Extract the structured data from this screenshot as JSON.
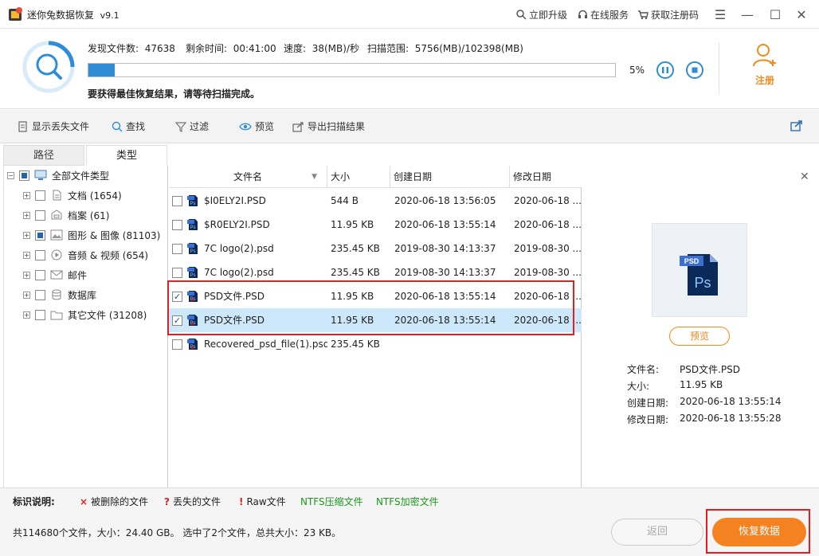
{
  "app": {
    "title": "迷你兔数据恢复",
    "version": "v9.1",
    "links": {
      "upgrade": "立即升级",
      "service": "在线服务",
      "get_code": "获取注册码"
    }
  },
  "scan": {
    "found_label": "发现文件数:",
    "found_value": "47638",
    "remaining_label": "剩余时间:",
    "remaining_value": "00:41:00",
    "speed_label": "速度:",
    "speed_value": "38(MB)/秒",
    "range_label": "扫描范围:",
    "range_value": "5756(MB)/102398(MB)",
    "progress_percent": 5,
    "progress_text": "5%",
    "message": "要获得最佳恢复结果，请等待扫描完成。",
    "register_label": "注册"
  },
  "toolbar": {
    "show_lost": "显示丢失文件",
    "find": "查找",
    "filter": "过滤",
    "preview": "预览",
    "export": "导出扫描结果"
  },
  "tabs": {
    "path": "路径",
    "type": "类型"
  },
  "tree": {
    "root": "全部文件类型",
    "items": [
      {
        "label": "文档 (1654)",
        "icon": "document-icon",
        "state": "none"
      },
      {
        "label": "档案 (61)",
        "icon": "archive-icon",
        "state": "none"
      },
      {
        "label": "图形 & 图像 (81103)",
        "icon": "image-icon",
        "state": "partial"
      },
      {
        "label": "音频 & 视频 (654)",
        "icon": "media-icon",
        "state": "none"
      },
      {
        "label": "邮件",
        "icon": "mail-icon",
        "state": "none"
      },
      {
        "label": "数据库",
        "icon": "database-icon",
        "state": "none"
      },
      {
        "label": "其它文件 (31208)",
        "icon": "folder-icon",
        "state": "none"
      }
    ]
  },
  "table": {
    "headers": {
      "name": "文件名",
      "size": "大小",
      "created": "创建日期",
      "modified": "修改日期"
    },
    "rows": [
      {
        "name": "$I0ELY2I.PSD",
        "size": "544 B",
        "created": "2020-06-18 13:56:05",
        "modified": "2020-06-18 ...",
        "checked": false,
        "deleted": false
      },
      {
        "name": "$R0ELY2I.PSD",
        "size": "11.95 KB",
        "created": "2020-06-18 13:55:14",
        "modified": "2020-06-18 ...",
        "checked": false,
        "deleted": false
      },
      {
        "name": "7C logo(2).psd",
        "size": "235.45 KB",
        "created": "2019-08-30 14:13:37",
        "modified": "2019-08-30 ...",
        "checked": false,
        "deleted": false
      },
      {
        "name": "7C logo(2).psd",
        "size": "235.45 KB",
        "created": "2019-08-30 14:13:37",
        "modified": "2019-08-30 ...",
        "checked": false,
        "deleted": false
      },
      {
        "name": "PSD文件.PSD",
        "size": "11.95 KB",
        "created": "2020-06-18 13:55:14",
        "modified": "2020-06-18 ...",
        "checked": true,
        "deleted": true
      },
      {
        "name": "PSD文件.PSD",
        "size": "11.95 KB",
        "created": "2020-06-18 13:55:14",
        "modified": "2020-06-18 ...",
        "checked": true,
        "deleted": true
      },
      {
        "name": "Recovered_psd_file(1).psd",
        "size": "235.45 KB",
        "created": "",
        "modified": "",
        "checked": false,
        "deleted": true
      }
    ]
  },
  "preview": {
    "thumb_badge": "PSD",
    "thumb_text": "Ps",
    "button": "预览",
    "name_label": "文件名:",
    "name_value": "PSD文件.PSD",
    "size_label": "大小:",
    "size_value": "11.95 KB",
    "created_label": "创建日期:",
    "created_value": "2020-06-18 13:55:14",
    "modified_label": "修改日期:",
    "modified_value": "2020-06-18 13:55:28"
  },
  "legend": {
    "title": "标识说明:",
    "deleted": "被删除的文件",
    "lost": "丢失的文件",
    "raw": "Raw文件",
    "ntfs_compressed": "NTFS压缩文件",
    "ntfs_encrypted": "NTFS加密文件"
  },
  "status": {
    "summary": "共114680个文件，大小：24.40 GB。 选中了2个文件，总共大小：23 KB。",
    "back": "返回",
    "recover": "恢复数据"
  },
  "colors": {
    "accent_blue": "#2e8dd6",
    "accent_orange": "#f58220",
    "highlight_red": "#e02020",
    "ntfs_green": "#1a9a1a"
  }
}
